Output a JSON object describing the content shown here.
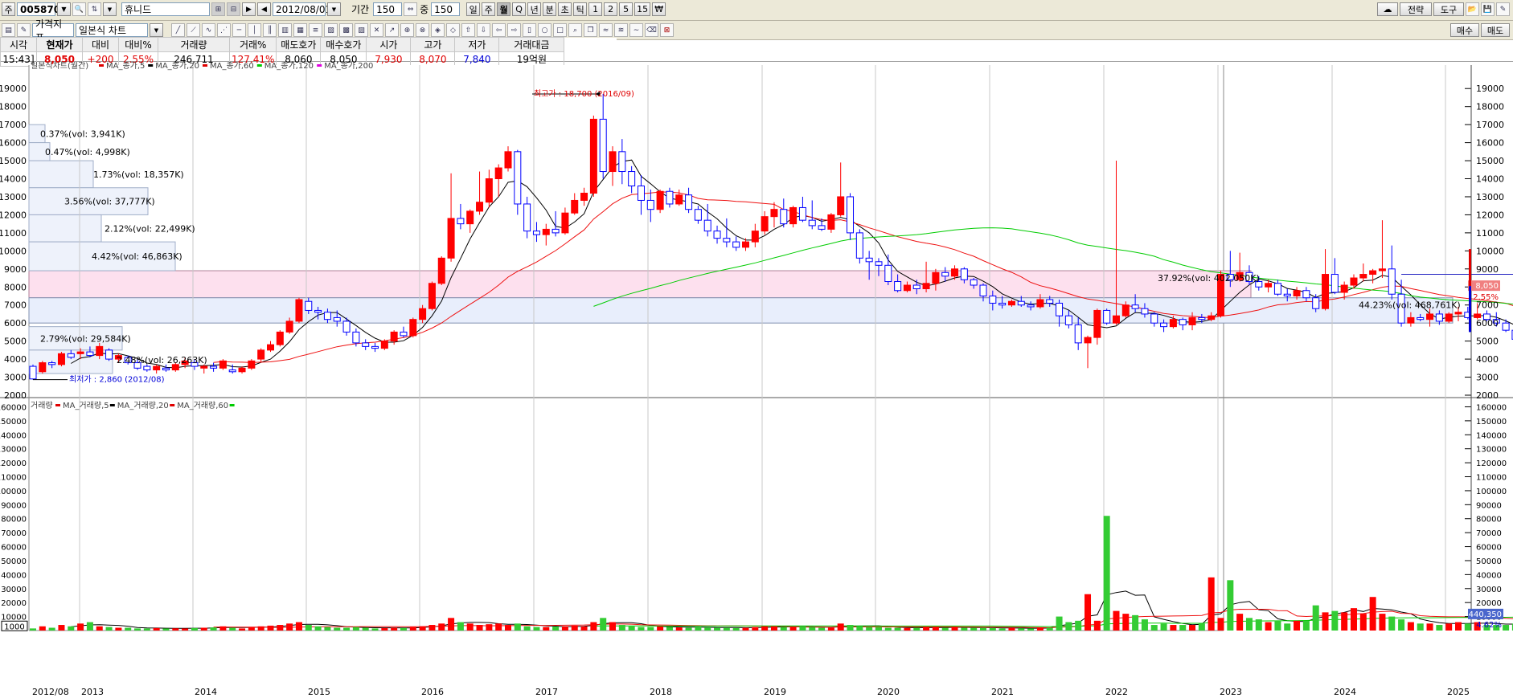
{
  "toolbar": {
    "code": "005870",
    "name": "휴니드",
    "date": "2012/08/01",
    "period_label": "기간",
    "period_value": "150",
    "count_value": "150",
    "periods": [
      "일",
      "주",
      "월",
      "Q",
      "년",
      "분",
      "초",
      "틱",
      "1",
      "2",
      "5",
      "15"
    ],
    "currency_symbol": "₩",
    "right_buttons": [
      "전략",
      "도구"
    ],
    "indicator_button": "가격지표",
    "chart_type_select": "일본식 차트",
    "buy_button": "매수",
    "sell_button": "매도",
    "left_tab": "주"
  },
  "quote": {
    "headers": [
      "시각",
      "현재가",
      "대비",
      "대비%",
      "거래량",
      "거래%",
      "매도호가",
      "매수호가",
      "시가",
      "고가",
      "저가",
      "거래대금"
    ],
    "values": [
      "15:43]",
      "8,050",
      "+200",
      "2.55%",
      "246,711",
      "127.41%",
      "8,060",
      "8,050",
      "7,930",
      "8,070",
      "7,840",
      "19억원"
    ]
  },
  "legend_price": {
    "title": "일본식차트(월간)",
    "items": [
      {
        "label": "MA_종가,5",
        "color": "#e00000"
      },
      {
        "label": "MA_종가,20",
        "color": "#000000"
      },
      {
        "label": "MA_종가,60",
        "color": "#e00000"
      },
      {
        "label": "MA_종가,120",
        "color": "#00cc00"
      },
      {
        "label": "MA_종가,200",
        "color": "#e000e0"
      }
    ]
  },
  "legend_volume": {
    "title": "거래량",
    "items": [
      {
        "label": "MA_거래량,5",
        "color": "#e00000"
      },
      {
        "label": "MA_거래량,20",
        "color": "#000000"
      },
      {
        "label": "MA_거래량,60",
        "color": "#e00000"
      },
      {
        "label": "",
        "color": "#00cc00"
      }
    ]
  },
  "price_axis": {
    "ticks": [
      2000,
      3000,
      4000,
      5000,
      6000,
      7000,
      8000,
      9000,
      10000,
      11000,
      12000,
      13000,
      14000,
      15000,
      16000,
      17000,
      18000,
      19000
    ]
  },
  "volume_axis": {
    "ticks": [
      10000,
      20000,
      30000,
      40000,
      50000,
      60000,
      70000,
      80000,
      90000,
      100000,
      110000,
      120000,
      130000,
      140000,
      150000,
      160000
    ]
  },
  "badges": {
    "price": "8,050",
    "pct": "2.55%",
    "vol": "440,350",
    "vol_pct": "4.62%",
    "vol_left_box": "1000"
  },
  "annotations": {
    "high": "최고가 : 18,700 (2016/09)",
    "low": "최저가 : 2,860 (2012/08)"
  },
  "profile_labels": [
    "0.37%(vol: 3,941K)",
    "0.47%(vol: 4,998K)",
    "1.73%(vol: 18,357K)",
    "3.56%(vol: 37,777K)",
    "2.12%(vol: 22,499K)",
    "4.42%(vol: 46,863K)",
    "37.92%(vol: 402,050K)",
    "44.23%(vol: 468,761K)",
    "2.79%(vol: 29,584K)",
    "2.48%(vol: 26,263K)"
  ],
  "chart_data": {
    "type": "candlestick",
    "title": "일본식차트(월간)",
    "x_labels": [
      "2012/08",
      "2013",
      "2014",
      "2015",
      "2016",
      "2017",
      "2018",
      "2019",
      "2020",
      "2021",
      "2022",
      "2023",
      "2024",
      "2025"
    ],
    "y_range": [
      2000,
      19500
    ],
    "volume_range": [
      0,
      162000
    ],
    "start": "2012/08",
    "ohlc": [
      [
        3600,
        3700,
        2860,
        2900
      ],
      [
        3300,
        3900,
        3200,
        3800
      ],
      [
        3800,
        3900,
        3500,
        3700
      ],
      [
        3700,
        4400,
        3600,
        4300
      ],
      [
        4300,
        4500,
        4000,
        4100
      ],
      [
        4300,
        4600,
        4000,
        4400
      ],
      [
        4400,
        4700,
        4100,
        4200
      ],
      [
        4200,
        4900,
        4000,
        4700
      ],
      [
        4500,
        4600,
        3900,
        4000
      ],
      [
        4000,
        4300,
        3800,
        4200
      ],
      [
        4100,
        4200,
        3700,
        3800
      ],
      [
        3800,
        4000,
        3400,
        3500
      ],
      [
        3600,
        3700,
        3300,
        3400
      ],
      [
        3400,
        3700,
        3200,
        3600
      ],
      [
        3500,
        3700,
        3300,
        3400
      ],
      [
        3400,
        3800,
        3300,
        3700
      ],
      [
        3700,
        4100,
        3500,
        3900
      ],
      [
        3800,
        4000,
        3400,
        3600
      ],
      [
        3500,
        3700,
        3200,
        3600
      ],
      [
        3600,
        3800,
        3300,
        3500
      ],
      [
        3500,
        4000,
        3400,
        3900
      ],
      [
        3400,
        3700,
        3200,
        3300
      ],
      [
        3300,
        3600,
        3200,
        3500
      ],
      [
        3500,
        4000,
        3400,
        3900
      ],
      [
        4000,
        4600,
        3800,
        4500
      ],
      [
        4500,
        5000,
        4400,
        4800
      ],
      [
        4800,
        5600,
        4700,
        5500
      ],
      [
        5500,
        6300,
        5400,
        6100
      ],
      [
        6100,
        7400,
        6000,
        7300
      ],
      [
        7200,
        7400,
        6500,
        6700
      ],
      [
        6700,
        6900,
        6200,
        6600
      ],
      [
        6600,
        6800,
        6000,
        6200
      ],
      [
        6300,
        6700,
        5800,
        6100
      ],
      [
        6100,
        6300,
        5300,
        5500
      ],
      [
        5500,
        5700,
        4700,
        4900
      ],
      [
        4900,
        5100,
        4500,
        4700
      ],
      [
        4700,
        4900,
        4400,
        4600
      ],
      [
        4600,
        5100,
        4500,
        5000
      ],
      [
        5000,
        5600,
        4800,
        5500
      ],
      [
        5500,
        5800,
        5200,
        5300
      ],
      [
        5300,
        6300,
        5200,
        6200
      ],
      [
        6200,
        7000,
        6000,
        6800
      ],
      [
        6800,
        8300,
        6700,
        8200
      ],
      [
        8200,
        9700,
        8100,
        9600
      ],
      [
        9600,
        14300,
        9400,
        11800
      ],
      [
        11800,
        12600,
        11200,
        11500
      ],
      [
        11500,
        12300,
        11000,
        12200
      ],
      [
        12200,
        14400,
        12000,
        12700
      ],
      [
        12700,
        14500,
        12400,
        14000
      ],
      [
        14000,
        14800,
        13000,
        14600
      ],
      [
        14600,
        15800,
        14400,
        15500
      ],
      [
        15500,
        15600,
        12000,
        12600
      ],
      [
        12600,
        13000,
        10700,
        11100
      ],
      [
        11100,
        11600,
        10500,
        10900
      ],
      [
        10900,
        11500,
        10300,
        11200
      ],
      [
        11200,
        12200,
        10800,
        11000
      ],
      [
        11000,
        12400,
        10900,
        12100
      ],
      [
        12100,
        13200,
        12000,
        12800
      ],
      [
        12800,
        13500,
        12500,
        13200
      ],
      [
        13200,
        17500,
        13000,
        17300
      ],
      [
        17300,
        18700,
        14000,
        14400
      ],
      [
        14400,
        15800,
        13600,
        15500
      ],
      [
        15500,
        16200,
        13700,
        14400
      ],
      [
        14400,
        14700,
        13200,
        13600
      ],
      [
        13600,
        14200,
        12000,
        12800
      ],
      [
        12800,
        13400,
        11600,
        12300
      ],
      [
        12300,
        13400,
        12100,
        13300
      ],
      [
        13300,
        13500,
        12400,
        12600
      ],
      [
        12600,
        13400,
        12500,
        13100
      ],
      [
        13100,
        13500,
        12100,
        12300
      ],
      [
        12300,
        12500,
        11500,
        11700
      ],
      [
        11700,
        12600,
        10800,
        11100
      ],
      [
        11100,
        11400,
        10400,
        10700
      ],
      [
        10700,
        11800,
        10200,
        10500
      ],
      [
        10500,
        10800,
        10000,
        10200
      ],
      [
        10200,
        10700,
        10000,
        10500
      ],
      [
        10500,
        11500,
        10200,
        11100
      ],
      [
        11100,
        12200,
        10900,
        11900
      ],
      [
        11900,
        12700,
        11300,
        12300
      ],
      [
        12300,
        12900,
        11300,
        11500
      ],
      [
        11500,
        12500,
        11300,
        12400
      ],
      [
        12400,
        13000,
        11600,
        11700
      ],
      [
        11700,
        12800,
        11200,
        11400
      ],
      [
        11400,
        11800,
        11100,
        11200
      ],
      [
        11200,
        12100,
        11000,
        12000
      ],
      [
        12000,
        14900,
        11900,
        13000
      ],
      [
        13000,
        13200,
        10600,
        11000
      ],
      [
        11000,
        11200,
        9300,
        9600
      ],
      [
        9600,
        10000,
        8400,
        9400
      ],
      [
        9400,
        9600,
        8600,
        9200
      ],
      [
        9200,
        9800,
        8100,
        8300
      ],
      [
        8300,
        8700,
        7700,
        7800
      ],
      [
        7800,
        8300,
        7700,
        8100
      ],
      [
        8100,
        8400,
        7600,
        7900
      ],
      [
        7900,
        9400,
        7700,
        8200
      ],
      [
        8200,
        9000,
        7800,
        8800
      ],
      [
        8800,
        9100,
        8300,
        8600
      ],
      [
        8600,
        9200,
        8400,
        9000
      ],
      [
        9000,
        9100,
        8200,
        8400
      ],
      [
        8400,
        8500,
        7900,
        8100
      ],
      [
        8100,
        8200,
        7200,
        7500
      ],
      [
        7500,
        7800,
        6700,
        7100
      ],
      [
        7100,
        7500,
        6800,
        7000
      ],
      [
        7000,
        7300,
        6900,
        7200
      ],
      [
        7200,
        7500,
        6900,
        7000
      ],
      [
        7000,
        7200,
        6700,
        6900
      ],
      [
        6900,
        7600,
        6800,
        7300
      ],
      [
        7300,
        7500,
        6900,
        7100
      ],
      [
        7100,
        7300,
        5800,
        6400
      ],
      [
        6400,
        6700,
        5700,
        5900
      ],
      [
        5900,
        6300,
        4500,
        4900
      ],
      [
        4900,
        5300,
        3500,
        5200
      ],
      [
        5200,
        6800,
        4800,
        6700
      ],
      [
        6700,
        6800,
        5900,
        6000
      ],
      [
        6000,
        15000,
        5900,
        6400
      ],
      [
        6400,
        7200,
        6300,
        7000
      ],
      [
        7000,
        7600,
        6600,
        6800
      ],
      [
        6800,
        7100,
        6300,
        6500
      ],
      [
        6500,
        6600,
        5800,
        6000
      ],
      [
        6000,
        6200,
        5500,
        5800
      ],
      [
        5800,
        6400,
        5700,
        6200
      ],
      [
        6200,
        6300,
        5600,
        5900
      ],
      [
        5900,
        6600,
        5600,
        6300
      ],
      [
        6300,
        6500,
        6000,
        6200
      ],
      [
        6200,
        6600,
        6100,
        6400
      ],
      [
        6400,
        8900,
        6300,
        8700
      ],
      [
        8700,
        10000,
        8000,
        8400
      ],
      [
        8400,
        9900,
        8300,
        8800
      ],
      [
        8800,
        9200,
        8100,
        8300
      ],
      [
        8300,
        8600,
        7800,
        8000
      ],
      [
        8000,
        8400,
        7700,
        8200
      ],
      [
        8200,
        8400,
        7500,
        7600
      ],
      [
        7600,
        7900,
        7200,
        7500
      ],
      [
        7500,
        8000,
        7300,
        7800
      ],
      [
        7800,
        8000,
        7200,
        7400
      ],
      [
        7400,
        7600,
        6600,
        6800
      ],
      [
        6800,
        10100,
        6700,
        8700
      ],
      [
        8700,
        9600,
        7600,
        7700
      ],
      [
        7700,
        8300,
        7300,
        8100
      ],
      [
        8100,
        8700,
        7900,
        8500
      ],
      [
        8500,
        9300,
        8300,
        8700
      ],
      [
        8700,
        9000,
        8200,
        8900
      ],
      [
        8900,
        11700,
        8500,
        9000
      ],
      [
        9000,
        10300,
        7300,
        7600
      ],
      [
        7600,
        8400,
        5800,
        6000
      ],
      [
        6000,
        6600,
        5800,
        6300
      ],
      [
        6300,
        6500,
        6100,
        6200
      ],
      [
        6200,
        6800,
        5800,
        6500
      ],
      [
        6500,
        6700,
        5900,
        6100
      ],
      [
        6100,
        6600,
        6000,
        6500
      ],
      [
        6500,
        6900,
        6100,
        6600
      ],
      [
        6600,
        6900,
        6200,
        6300
      ],
      [
        6300,
        7100,
        6200,
        6500
      ],
      [
        6500,
        6700,
        6100,
        6200
      ],
      [
        6200,
        6600,
        5800,
        6000
      ],
      [
        6000,
        6200,
        5500,
        5600
      ],
      [
        5600,
        5800,
        4900,
        5100
      ],
      [
        5100,
        5400,
        4700,
        4900
      ],
      [
        4900,
        8600,
        4700,
        8500
      ],
      [
        8500,
        8800,
        5700,
        6300
      ],
      [
        6300,
        6700,
        5900,
        6200
      ],
      [
        6200,
        8700,
        6000,
        6400
      ],
      [
        6400,
        6900,
        6100,
        6800
      ],
      [
        6800,
        7100,
        6400,
        6700
      ],
      [
        6700,
        7400,
        6500,
        6900
      ],
      [
        6900,
        7300,
        6500,
        6800
      ],
      [
        6800,
        7100,
        6300,
        6500
      ],
      [
        6500,
        6900,
        6400,
        6800
      ],
      [
        6800,
        11300,
        6500,
        7500
      ],
      [
        7500,
        8300,
        7200,
        8200
      ],
      [
        8200,
        9100,
        7800,
        8500
      ],
      [
        8500,
        8800,
        7700,
        8200
      ],
      [
        8200,
        9800,
        7900,
        8800
      ],
      [
        8800,
        8900,
        7700,
        7900
      ],
      [
        7900,
        8200,
        7700,
        8050
      ]
    ],
    "volume": [
      1500,
      3000,
      2000,
      4000,
      3000,
      5000,
      6000,
      3000,
      2500,
      2000,
      2000,
      1500,
      1500,
      1800,
      1500,
      1600,
      1500,
      1800,
      2000,
      2200,
      3000,
      2000,
      1500,
      2500,
      3000,
      3500,
      4000,
      5000,
      6000,
      4000,
      3000,
      2500,
      2000,
      2000,
      2500,
      2000,
      1500,
      1800,
      2000,
      1800,
      2500,
      3000,
      4000,
      5000,
      9000,
      6000,
      5000,
      4000,
      4500,
      5000,
      4000,
      5000,
      3000,
      2500,
      2500,
      2800,
      3000,
      3500,
      3000,
      6000,
      9000,
      6000,
      4000,
      3000,
      2500,
      2500,
      3000,
      2500,
      2200,
      2000,
      2500,
      2200,
      2000,
      2000,
      1800,
      2000,
      2500,
      3000,
      3000,
      2500,
      2500,
      2800,
      2500,
      2000,
      2000,
      5000,
      4000,
      3000,
      2500,
      2500,
      2000,
      2000,
      1800,
      2000,
      2500,
      2500,
      2000,
      2500,
      2000,
      2000,
      2000,
      1800,
      1500,
      1800,
      1600,
      1500,
      2000,
      2000,
      10000,
      6000,
      7000,
      26000,
      7000,
      82000,
      14000,
      12000,
      11000,
      8000,
      4000,
      5000,
      4000,
      4000,
      4000,
      5000,
      38000,
      9000,
      36000,
      12000,
      9000,
      8000,
      6000,
      7000,
      5000,
      7000,
      7000,
      18000,
      13000,
      14000,
      13000,
      16000,
      12000,
      24000,
      12000,
      10000,
      8000,
      6000,
      5000,
      5000,
      4000,
      5000,
      6000,
      5000,
      6000,
      4000,
      4000,
      4000,
      5000,
      5000,
      154000,
      17000,
      9000,
      73000,
      10000,
      9000,
      17000,
      13000,
      8000,
      11000,
      105000,
      25000,
      32000,
      30000,
      15000,
      13000,
      12000
    ]
  }
}
